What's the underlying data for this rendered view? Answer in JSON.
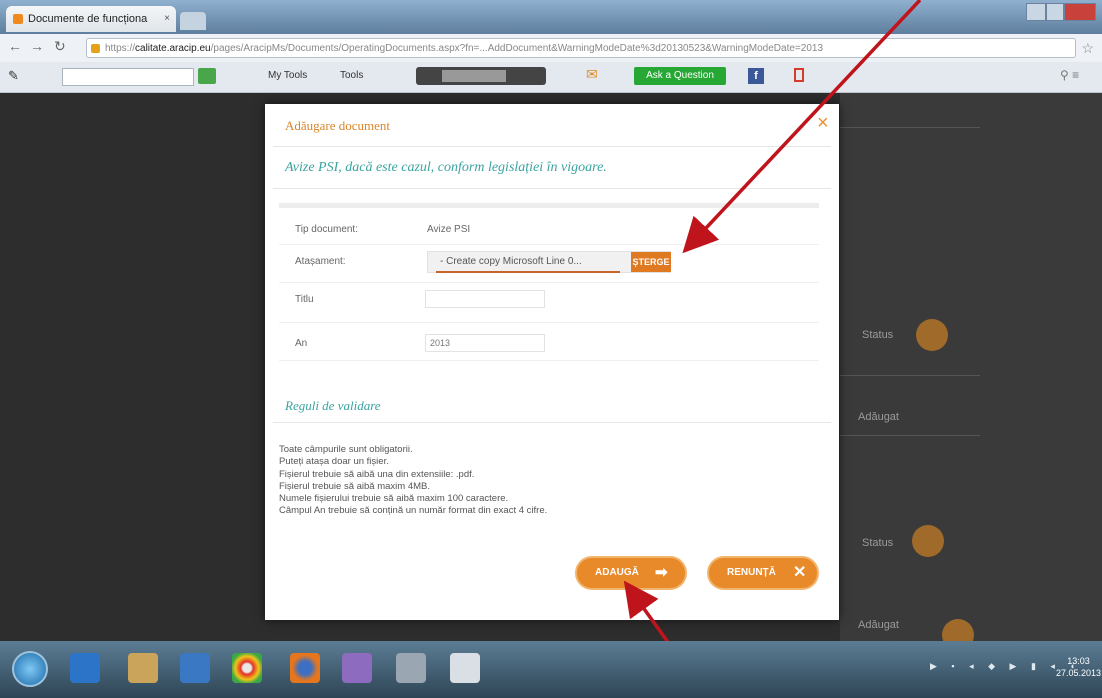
{
  "browser": {
    "tab_title": "Documente de funcționa",
    "tab_close": "×",
    "url_host": "calitate.aracip.eu",
    "url_rest": "/pages/AracipMs/Documents/OperatingDocuments.aspx?fn=...AddDocument&WarningModeDate%3d20130523&WarningModeDate=2013",
    "toolbar_items": [
      "My Tools",
      "Tools"
    ],
    "ask_button": "Ask a Question",
    "fb_icon": "f"
  },
  "modal": {
    "title": "Adăugare document",
    "close": "×",
    "subtitle": "Avize PSI, dacă este cazul, conform legislației în vigoare.",
    "fields": {
      "doc_type_label": "Tip document:",
      "doc_type_value": "Avize PSI",
      "attachment_label": "Atașament:",
      "attachment_file": "- Create copy Microsoft Line 0...",
      "delete_button": "ȘTERGE",
      "title_label": "Titlu",
      "title_value": "",
      "year_label": "An",
      "year_value": "2013"
    },
    "rules_title": "Reguli de validare",
    "rules": [
      "Toate câmpurile sunt obligatorii.",
      "Puteți atașa doar un fișier.",
      "Fișierul trebuie să aibă una din extensiile: .pdf.",
      "Fișierul trebuie să aibă maxim 4MB.",
      "Numele fișierului trebuie să aibă maxim 100 caractere.",
      "Câmpul An trebuie să conțină un număr format din exact 4 cifre."
    ],
    "add_button": "ADAUGĂ",
    "cancel_button": "RENUNȚĂ"
  },
  "background": {
    "right_label_1": "Status",
    "right_label_2": "Adăugat",
    "right_label_3": "Status",
    "right_label_4": "Adăugat"
  },
  "taskbar": {
    "clock_time": "13:03",
    "clock_date": "27.05.2013"
  },
  "colors": {
    "accent_orange": "#e8892a",
    "teal_heading": "#3aa3a0",
    "arrow_red": "#c0141c"
  }
}
